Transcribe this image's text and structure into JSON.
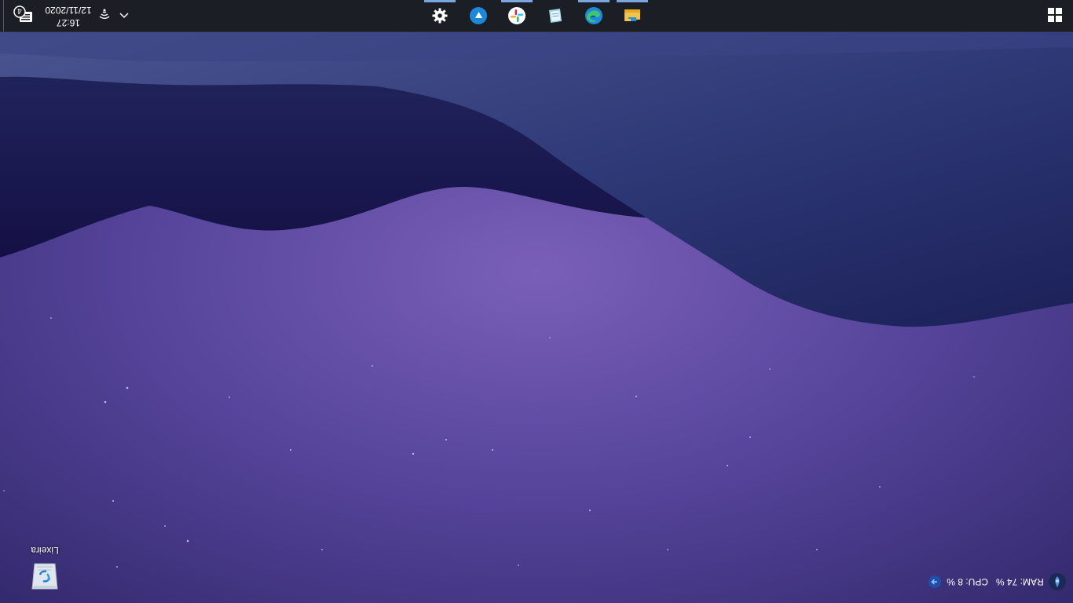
{
  "colors": {
    "taskbar_bg": "#1c1e26",
    "active_indicator": "#7aa7e0",
    "wallpaper_sky": "#3a3172",
    "wallpaper_dune_dark": "#1f1a52",
    "wallpaper_dune_mid": "#2c3272"
  },
  "taskbar": {
    "start_icon": "windows-logo-icon",
    "apps": [
      {
        "name": "settings",
        "icon": "gear-icon",
        "active": true
      },
      {
        "name": "media-player",
        "icon": "play-circle-icon",
        "active": false
      },
      {
        "name": "slack",
        "icon": "slack-icon",
        "active": true
      },
      {
        "name": "notepad",
        "icon": "notepad-icon",
        "active": false
      },
      {
        "name": "edge",
        "icon": "edge-icon",
        "active": true
      },
      {
        "name": "file-explorer",
        "icon": "folder-icon",
        "active": true
      }
    ]
  },
  "tray": {
    "time": "16:27",
    "date": "12/11/2020",
    "notification_count": "4"
  },
  "desktop": {
    "recycle_bin_label": "Lixeira"
  },
  "sysmon": {
    "ram": "RAM: 74 %",
    "cpu": "CPU: 8 %"
  }
}
